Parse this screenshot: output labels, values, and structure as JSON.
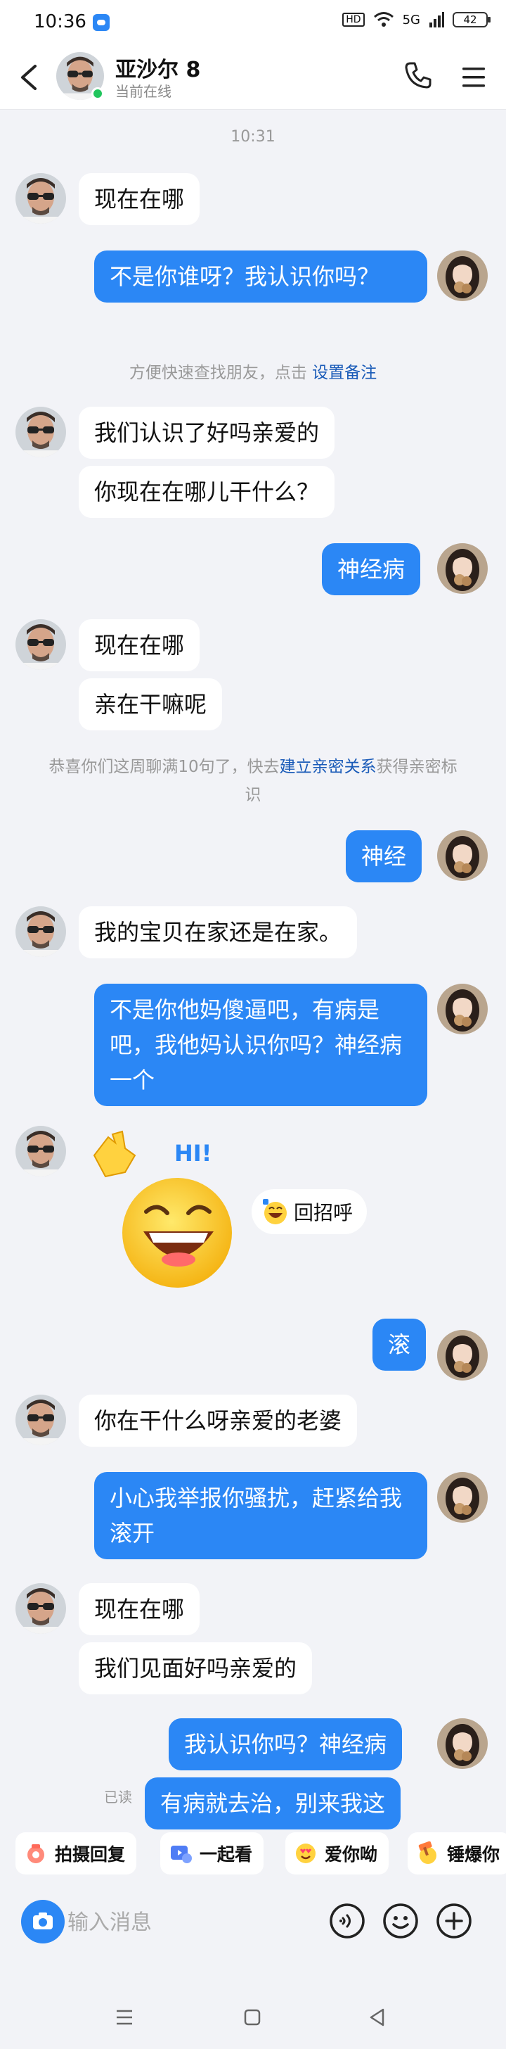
{
  "status_bar": {
    "time": "10:36",
    "hd_label": "HD",
    "network": "5G",
    "battery": "42"
  },
  "header": {
    "contact_name": "亚沙尔 8",
    "presence": "当前在线"
  },
  "chat": {
    "timestamp": "10:31",
    "messages": [
      {
        "from": "them",
        "text": "现在在哪"
      },
      {
        "from": "me",
        "text": "不是你谁呀？我认识你吗？"
      },
      {
        "from": "them",
        "text": "我们认识了好吗亲爱的"
      },
      {
        "from": "them",
        "text": "你现在在哪儿干什么？"
      },
      {
        "from": "me",
        "text": "神经病"
      },
      {
        "from": "them",
        "text": "现在在哪"
      },
      {
        "from": "them",
        "text": "亲在干嘛呢"
      },
      {
        "from": "me",
        "text": "神经"
      },
      {
        "from": "them",
        "text": "我的宝贝在家还是在家。"
      },
      {
        "from": "me",
        "text": "不是你他妈傻逼吧，有病是吧，我他妈认识你吗？神经病一个"
      },
      {
        "from": "me",
        "text": "滚"
      },
      {
        "from": "them",
        "text": "你在干什么呀亲爱的老婆"
      },
      {
        "from": "me",
        "text": "小心我举报你骚扰，赶紧给我滚开"
      },
      {
        "from": "them",
        "text": "现在在哪"
      },
      {
        "from": "them",
        "text": "我们见面好吗亲爱的"
      },
      {
        "from": "me",
        "text": "我认识你吗？神经病"
      },
      {
        "from": "me",
        "text": "有病就去治，别来我这"
      }
    ],
    "remark_note": {
      "prefix": "方便快速查找朋友，点击 ",
      "link": "设置备注"
    },
    "intimacy_note": {
      "prefix": "恭喜你们这周聊满10句了，快去",
      "link": "建立亲密关系",
      "suffix": "获得亲密标识"
    },
    "sticker": {
      "overlay_text": "HI!",
      "reply_label": "回招呼"
    },
    "read_label": "已读"
  },
  "quick_actions": [
    "拍摄回复",
    "一起看",
    "爱你呦",
    "锤爆你"
  ],
  "input": {
    "placeholder": "输入消息"
  },
  "colors": {
    "accent": "#2b87f5",
    "background": "#f2f3f7",
    "online": "#21c55d"
  }
}
